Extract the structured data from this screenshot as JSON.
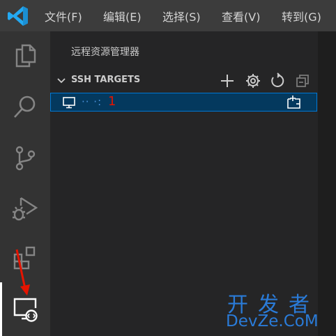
{
  "menu": {
    "items": [
      {
        "label": "文件(F)"
      },
      {
        "label": "编辑(E)"
      },
      {
        "label": "选择(S)"
      },
      {
        "label": "查看(V)"
      },
      {
        "label": "转到(G)"
      }
    ]
  },
  "activity_bar": {
    "items": [
      {
        "icon": "files-icon"
      },
      {
        "icon": "search-icon"
      },
      {
        "icon": "source-control-icon"
      },
      {
        "icon": "run-debug-icon"
      },
      {
        "icon": "extensions-icon"
      },
      {
        "icon": "remote-explorer-icon",
        "active": true
      }
    ]
  },
  "sidebar": {
    "title": "远程资源管理器",
    "section": {
      "title": "SSH TARGETS",
      "actions": [
        "add-icon",
        "gear-icon",
        "refresh-icon",
        "collapse-all-icon"
      ]
    },
    "targets": [
      {
        "host": "·· ·:",
        "annotation": "1",
        "action_icon": "connect-new-window-icon"
      }
    ]
  },
  "watermark": {
    "line1": "开发者",
    "line2": "DevZe.CoM"
  },
  "colors": {
    "titlebar": "#3c3c3c",
    "activitybar": "#333333",
    "sidebar": "#252526",
    "selection": "#04395e",
    "focus_border": "#0078d4",
    "vscode_blue": "#23a9f2",
    "annotation_red": "#e51400",
    "watermark_blue": "#2a7bd8"
  }
}
